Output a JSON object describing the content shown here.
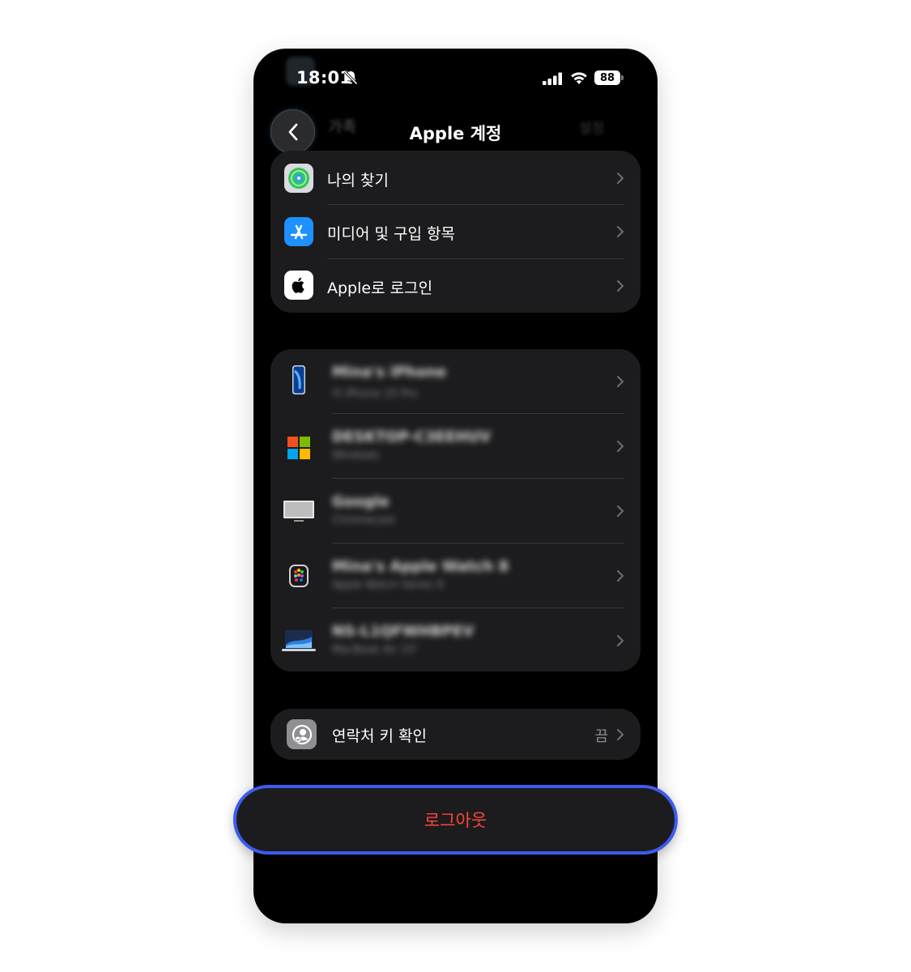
{
  "status_bar": {
    "time": "18:01",
    "battery": "88"
  },
  "nav": {
    "title": "Apple 계정",
    "ghost_item": "가족",
    "ghost_value": "설정"
  },
  "services": [
    {
      "label": "나의 찾기",
      "icon": "find-my-icon"
    },
    {
      "label": "미디어 및 구입 항목",
      "icon": "app-store-icon"
    },
    {
      "label": "Apple로 로그인",
      "icon": "apple-logo-icon"
    }
  ],
  "devices": [
    {
      "name": "Mina's iPhone",
      "model": "이 iPhone 15 Pro",
      "icon": "iphone-icon"
    },
    {
      "name": "DESKTOP-C3EEHUV",
      "model": "Windows",
      "icon": "windows-icon"
    },
    {
      "name": "Google",
      "model": "Chromecast",
      "icon": "tv-icon"
    },
    {
      "name": "Mina's Apple Watch 8",
      "model": "Apple Watch Series 8",
      "icon": "apple-watch-icon"
    },
    {
      "name": "NS-L1QFWHBPEV",
      "model": "MacBook Air 15\"",
      "icon": "macbook-icon"
    }
  ],
  "contact_key": {
    "label": "연락처 키 확인",
    "value": "끔",
    "icon": "contact-key-icon"
  },
  "logout": {
    "label": "로그아웃"
  },
  "colors": {
    "background": "#000000",
    "group": "#1c1c1e",
    "destructive": "#ff453a",
    "highlight": "#3d5bf0"
  }
}
